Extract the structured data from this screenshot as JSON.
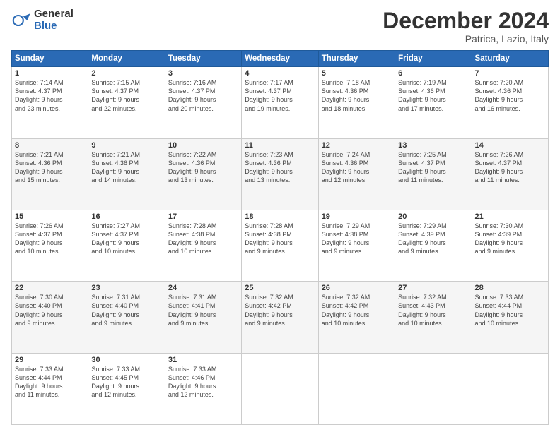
{
  "logo": {
    "general": "General",
    "blue": "Blue"
  },
  "title": {
    "month": "December 2024",
    "location": "Patrica, Lazio, Italy"
  },
  "days_of_week": [
    "Sunday",
    "Monday",
    "Tuesday",
    "Wednesday",
    "Thursday",
    "Friday",
    "Saturday"
  ],
  "weeks": [
    [
      {
        "day": "1",
        "info": "Sunrise: 7:14 AM\nSunset: 4:37 PM\nDaylight: 9 hours\nand 23 minutes."
      },
      {
        "day": "2",
        "info": "Sunrise: 7:15 AM\nSunset: 4:37 PM\nDaylight: 9 hours\nand 22 minutes."
      },
      {
        "day": "3",
        "info": "Sunrise: 7:16 AM\nSunset: 4:37 PM\nDaylight: 9 hours\nand 20 minutes."
      },
      {
        "day": "4",
        "info": "Sunrise: 7:17 AM\nSunset: 4:37 PM\nDaylight: 9 hours\nand 19 minutes."
      },
      {
        "day": "5",
        "info": "Sunrise: 7:18 AM\nSunset: 4:36 PM\nDaylight: 9 hours\nand 18 minutes."
      },
      {
        "day": "6",
        "info": "Sunrise: 7:19 AM\nSunset: 4:36 PM\nDaylight: 9 hours\nand 17 minutes."
      },
      {
        "day": "7",
        "info": "Sunrise: 7:20 AM\nSunset: 4:36 PM\nDaylight: 9 hours\nand 16 minutes."
      }
    ],
    [
      {
        "day": "8",
        "info": "Sunrise: 7:21 AM\nSunset: 4:36 PM\nDaylight: 9 hours\nand 15 minutes."
      },
      {
        "day": "9",
        "info": "Sunrise: 7:21 AM\nSunset: 4:36 PM\nDaylight: 9 hours\nand 14 minutes."
      },
      {
        "day": "10",
        "info": "Sunrise: 7:22 AM\nSunset: 4:36 PM\nDaylight: 9 hours\nand 13 minutes."
      },
      {
        "day": "11",
        "info": "Sunrise: 7:23 AM\nSunset: 4:36 PM\nDaylight: 9 hours\nand 13 minutes."
      },
      {
        "day": "12",
        "info": "Sunrise: 7:24 AM\nSunset: 4:36 PM\nDaylight: 9 hours\nand 12 minutes."
      },
      {
        "day": "13",
        "info": "Sunrise: 7:25 AM\nSunset: 4:37 PM\nDaylight: 9 hours\nand 11 minutes."
      },
      {
        "day": "14",
        "info": "Sunrise: 7:26 AM\nSunset: 4:37 PM\nDaylight: 9 hours\nand 11 minutes."
      }
    ],
    [
      {
        "day": "15",
        "info": "Sunrise: 7:26 AM\nSunset: 4:37 PM\nDaylight: 9 hours\nand 10 minutes."
      },
      {
        "day": "16",
        "info": "Sunrise: 7:27 AM\nSunset: 4:37 PM\nDaylight: 9 hours\nand 10 minutes."
      },
      {
        "day": "17",
        "info": "Sunrise: 7:28 AM\nSunset: 4:38 PM\nDaylight: 9 hours\nand 10 minutes."
      },
      {
        "day": "18",
        "info": "Sunrise: 7:28 AM\nSunset: 4:38 PM\nDaylight: 9 hours\nand 9 minutes."
      },
      {
        "day": "19",
        "info": "Sunrise: 7:29 AM\nSunset: 4:38 PM\nDaylight: 9 hours\nand 9 minutes."
      },
      {
        "day": "20",
        "info": "Sunrise: 7:29 AM\nSunset: 4:39 PM\nDaylight: 9 hours\nand 9 minutes."
      },
      {
        "day": "21",
        "info": "Sunrise: 7:30 AM\nSunset: 4:39 PM\nDaylight: 9 hours\nand 9 minutes."
      }
    ],
    [
      {
        "day": "22",
        "info": "Sunrise: 7:30 AM\nSunset: 4:40 PM\nDaylight: 9 hours\nand 9 minutes."
      },
      {
        "day": "23",
        "info": "Sunrise: 7:31 AM\nSunset: 4:40 PM\nDaylight: 9 hours\nand 9 minutes."
      },
      {
        "day": "24",
        "info": "Sunrise: 7:31 AM\nSunset: 4:41 PM\nDaylight: 9 hours\nand 9 minutes."
      },
      {
        "day": "25",
        "info": "Sunrise: 7:32 AM\nSunset: 4:42 PM\nDaylight: 9 hours\nand 9 minutes."
      },
      {
        "day": "26",
        "info": "Sunrise: 7:32 AM\nSunset: 4:42 PM\nDaylight: 9 hours\nand 10 minutes."
      },
      {
        "day": "27",
        "info": "Sunrise: 7:32 AM\nSunset: 4:43 PM\nDaylight: 9 hours\nand 10 minutes."
      },
      {
        "day": "28",
        "info": "Sunrise: 7:33 AM\nSunset: 4:44 PM\nDaylight: 9 hours\nand 10 minutes."
      }
    ],
    [
      {
        "day": "29",
        "info": "Sunrise: 7:33 AM\nSunset: 4:44 PM\nDaylight: 9 hours\nand 11 minutes."
      },
      {
        "day": "30",
        "info": "Sunrise: 7:33 AM\nSunset: 4:45 PM\nDaylight: 9 hours\nand 12 minutes."
      },
      {
        "day": "31",
        "info": "Sunrise: 7:33 AM\nSunset: 4:46 PM\nDaylight: 9 hours\nand 12 minutes."
      },
      null,
      null,
      null,
      null
    ]
  ]
}
